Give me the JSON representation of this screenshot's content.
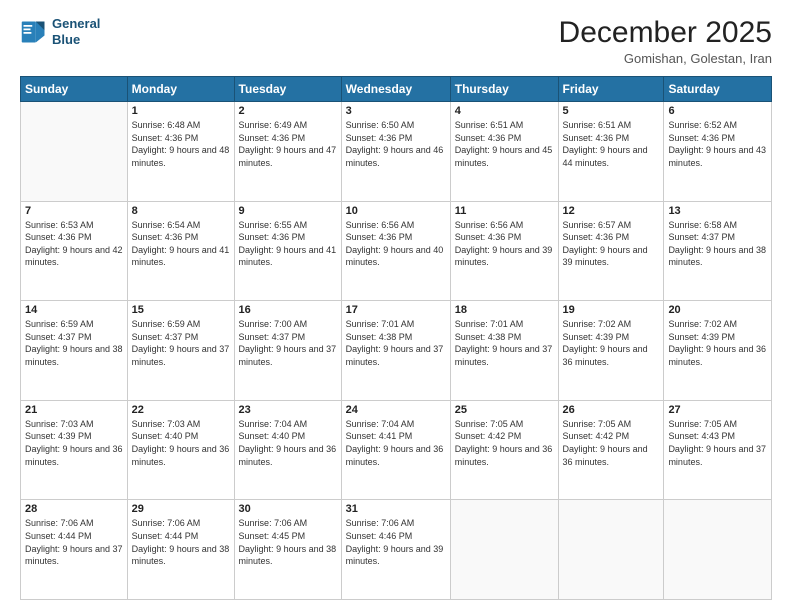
{
  "header": {
    "logo_line1": "General",
    "logo_line2": "Blue",
    "month_title": "December 2025",
    "location": "Gomishan, Golestan, Iran"
  },
  "weekdays": [
    "Sunday",
    "Monday",
    "Tuesday",
    "Wednesday",
    "Thursday",
    "Friday",
    "Saturday"
  ],
  "weeks": [
    [
      {
        "day": "",
        "sunrise": "",
        "sunset": "",
        "daylight": ""
      },
      {
        "day": "1",
        "sunrise": "Sunrise: 6:48 AM",
        "sunset": "Sunset: 4:36 PM",
        "daylight": "Daylight: 9 hours and 48 minutes."
      },
      {
        "day": "2",
        "sunrise": "Sunrise: 6:49 AM",
        "sunset": "Sunset: 4:36 PM",
        "daylight": "Daylight: 9 hours and 47 minutes."
      },
      {
        "day": "3",
        "sunrise": "Sunrise: 6:50 AM",
        "sunset": "Sunset: 4:36 PM",
        "daylight": "Daylight: 9 hours and 46 minutes."
      },
      {
        "day": "4",
        "sunrise": "Sunrise: 6:51 AM",
        "sunset": "Sunset: 4:36 PM",
        "daylight": "Daylight: 9 hours and 45 minutes."
      },
      {
        "day": "5",
        "sunrise": "Sunrise: 6:51 AM",
        "sunset": "Sunset: 4:36 PM",
        "daylight": "Daylight: 9 hours and 44 minutes."
      },
      {
        "day": "6",
        "sunrise": "Sunrise: 6:52 AM",
        "sunset": "Sunset: 4:36 PM",
        "daylight": "Daylight: 9 hours and 43 minutes."
      }
    ],
    [
      {
        "day": "7",
        "sunrise": "Sunrise: 6:53 AM",
        "sunset": "Sunset: 4:36 PM",
        "daylight": "Daylight: 9 hours and 42 minutes."
      },
      {
        "day": "8",
        "sunrise": "Sunrise: 6:54 AM",
        "sunset": "Sunset: 4:36 PM",
        "daylight": "Daylight: 9 hours and 41 minutes."
      },
      {
        "day": "9",
        "sunrise": "Sunrise: 6:55 AM",
        "sunset": "Sunset: 4:36 PM",
        "daylight": "Daylight: 9 hours and 41 minutes."
      },
      {
        "day": "10",
        "sunrise": "Sunrise: 6:56 AM",
        "sunset": "Sunset: 4:36 PM",
        "daylight": "Daylight: 9 hours and 40 minutes."
      },
      {
        "day": "11",
        "sunrise": "Sunrise: 6:56 AM",
        "sunset": "Sunset: 4:36 PM",
        "daylight": "Daylight: 9 hours and 39 minutes."
      },
      {
        "day": "12",
        "sunrise": "Sunrise: 6:57 AM",
        "sunset": "Sunset: 4:36 PM",
        "daylight": "Daylight: 9 hours and 39 minutes."
      },
      {
        "day": "13",
        "sunrise": "Sunrise: 6:58 AM",
        "sunset": "Sunset: 4:37 PM",
        "daylight": "Daylight: 9 hours and 38 minutes."
      }
    ],
    [
      {
        "day": "14",
        "sunrise": "Sunrise: 6:59 AM",
        "sunset": "Sunset: 4:37 PM",
        "daylight": "Daylight: 9 hours and 38 minutes."
      },
      {
        "day": "15",
        "sunrise": "Sunrise: 6:59 AM",
        "sunset": "Sunset: 4:37 PM",
        "daylight": "Daylight: 9 hours and 37 minutes."
      },
      {
        "day": "16",
        "sunrise": "Sunrise: 7:00 AM",
        "sunset": "Sunset: 4:37 PM",
        "daylight": "Daylight: 9 hours and 37 minutes."
      },
      {
        "day": "17",
        "sunrise": "Sunrise: 7:01 AM",
        "sunset": "Sunset: 4:38 PM",
        "daylight": "Daylight: 9 hours and 37 minutes."
      },
      {
        "day": "18",
        "sunrise": "Sunrise: 7:01 AM",
        "sunset": "Sunset: 4:38 PM",
        "daylight": "Daylight: 9 hours and 37 minutes."
      },
      {
        "day": "19",
        "sunrise": "Sunrise: 7:02 AM",
        "sunset": "Sunset: 4:39 PM",
        "daylight": "Daylight: 9 hours and 36 minutes."
      },
      {
        "day": "20",
        "sunrise": "Sunrise: 7:02 AM",
        "sunset": "Sunset: 4:39 PM",
        "daylight": "Daylight: 9 hours and 36 minutes."
      }
    ],
    [
      {
        "day": "21",
        "sunrise": "Sunrise: 7:03 AM",
        "sunset": "Sunset: 4:39 PM",
        "daylight": "Daylight: 9 hours and 36 minutes."
      },
      {
        "day": "22",
        "sunrise": "Sunrise: 7:03 AM",
        "sunset": "Sunset: 4:40 PM",
        "daylight": "Daylight: 9 hours and 36 minutes."
      },
      {
        "day": "23",
        "sunrise": "Sunrise: 7:04 AM",
        "sunset": "Sunset: 4:40 PM",
        "daylight": "Daylight: 9 hours and 36 minutes."
      },
      {
        "day": "24",
        "sunrise": "Sunrise: 7:04 AM",
        "sunset": "Sunset: 4:41 PM",
        "daylight": "Daylight: 9 hours and 36 minutes."
      },
      {
        "day": "25",
        "sunrise": "Sunrise: 7:05 AM",
        "sunset": "Sunset: 4:42 PM",
        "daylight": "Daylight: 9 hours and 36 minutes."
      },
      {
        "day": "26",
        "sunrise": "Sunrise: 7:05 AM",
        "sunset": "Sunset: 4:42 PM",
        "daylight": "Daylight: 9 hours and 36 minutes."
      },
      {
        "day": "27",
        "sunrise": "Sunrise: 7:05 AM",
        "sunset": "Sunset: 4:43 PM",
        "daylight": "Daylight: 9 hours and 37 minutes."
      }
    ],
    [
      {
        "day": "28",
        "sunrise": "Sunrise: 7:06 AM",
        "sunset": "Sunset: 4:44 PM",
        "daylight": "Daylight: 9 hours and 37 minutes."
      },
      {
        "day": "29",
        "sunrise": "Sunrise: 7:06 AM",
        "sunset": "Sunset: 4:44 PM",
        "daylight": "Daylight: 9 hours and 38 minutes."
      },
      {
        "day": "30",
        "sunrise": "Sunrise: 7:06 AM",
        "sunset": "Sunset: 4:45 PM",
        "daylight": "Daylight: 9 hours and 38 minutes."
      },
      {
        "day": "31",
        "sunrise": "Sunrise: 7:06 AM",
        "sunset": "Sunset: 4:46 PM",
        "daylight": "Daylight: 9 hours and 39 minutes."
      },
      {
        "day": "",
        "sunrise": "",
        "sunset": "",
        "daylight": ""
      },
      {
        "day": "",
        "sunrise": "",
        "sunset": "",
        "daylight": ""
      },
      {
        "day": "",
        "sunrise": "",
        "sunset": "",
        "daylight": ""
      }
    ]
  ]
}
